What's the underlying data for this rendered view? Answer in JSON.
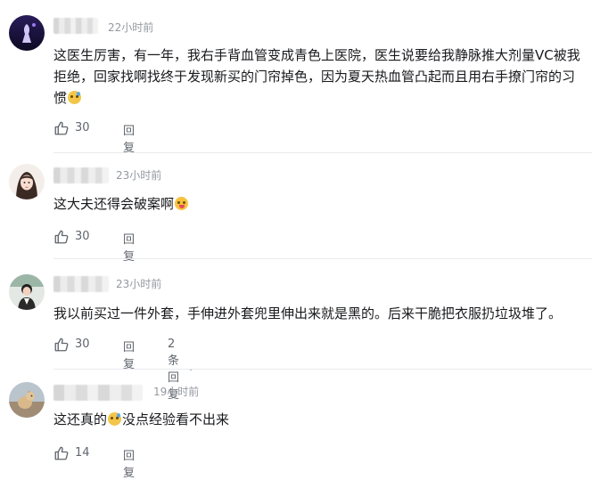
{
  "comments": [
    {
      "time": "22小时前",
      "text_parts": [
        "这医生厉害，有一年，我右手背血管变成青色上医院，医生说要给我静脉推大剂量VC被我拒绝，回家找啊找终于发现新买的门帘掉色，因为夏天热血管凸起而且用右手撩门帘的习惯"
      ],
      "emoji_after": "sweat-emoji",
      "likes": "30",
      "reply_label": "回复"
    },
    {
      "time": "23小时前",
      "text_parts": [
        "这大夫还得会破案啊"
      ],
      "emoji_after": "tongue-emoji",
      "likes": "30",
      "reply_label": "回复"
    },
    {
      "time": "23小时前",
      "text_parts": [
        "我以前买过一件外套，手伸进外套兜里伸出来就是黑的。后来干脆把衣服扔垃圾堆了。"
      ],
      "likes": "30",
      "reply_label": "回复",
      "replies_label": "2条回复"
    },
    {
      "time": "19小时前",
      "text_parts": [
        "这还真的",
        "没点经验看不出来"
      ],
      "emoji_middle": "sweat-emoji",
      "likes": "14",
      "reply_label": "回复"
    }
  ],
  "colors": {
    "text": "#18191c",
    "meta": "#9499a0",
    "action": "#61666d",
    "divider": "#e9ebee"
  },
  "icons": {
    "like": "thumbs-up-icon",
    "expand": "chevron-down-icon"
  }
}
